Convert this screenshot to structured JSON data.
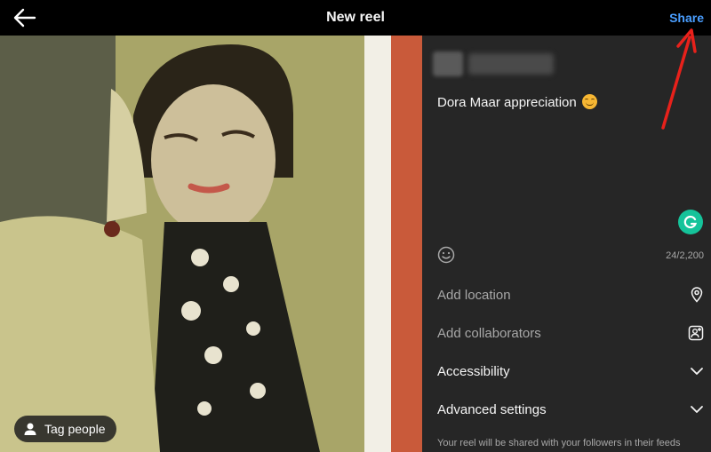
{
  "header": {
    "title": "New reel",
    "share_label": "Share",
    "back_icon": "arrow-left-icon"
  },
  "media": {
    "tag_people_label": "Tag people",
    "tag_icon": "person-icon"
  },
  "panel": {
    "caption": "Dora Maar appreciation",
    "caption_emoji": "smiling-face-icon",
    "char_count": "24/2,200",
    "rows": [
      {
        "label": "Add location",
        "icon": "location-pin-icon"
      },
      {
        "label": "Add collaborators",
        "icon": "add-person-icon"
      },
      {
        "label": "Accessibility",
        "icon": "chevron-down-icon"
      },
      {
        "label": "Advanced settings",
        "icon": "chevron-down-icon"
      }
    ],
    "footer_note": "Your reel will be shared with your followers in their feeds"
  },
  "colors": {
    "header_bg": "#000000",
    "panel_bg": "#262626",
    "share_blue": "#4a9eff",
    "annotation_red": "#e8211b",
    "grammarly_green": "#15c39a"
  }
}
